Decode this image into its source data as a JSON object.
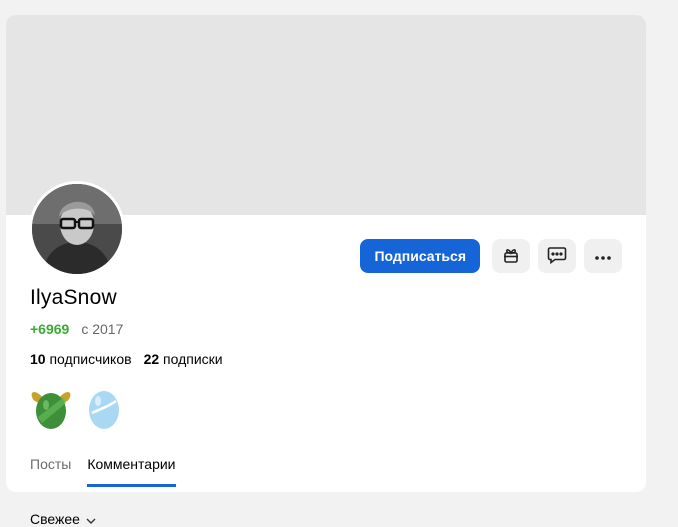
{
  "profile": {
    "name": "IlyaSnow",
    "karma": "+6969",
    "since": "с 2017",
    "subscribers_count": "10",
    "subscribers_label": "подписчиков",
    "subscriptions_count": "22",
    "subscriptions_label": "подписки"
  },
  "actions": {
    "subscribe_label": "Подписаться",
    "gift_icon": "gift-icon",
    "message_icon": "message-icon",
    "more_icon": "more-icon"
  },
  "badges": [
    "winged-green-egg-badge",
    "blue-egg-badge"
  ],
  "tabs": [
    {
      "label": "Посты",
      "active": false
    },
    {
      "label": "Комментарии",
      "active": true
    }
  ],
  "sort": {
    "label": "Свежее"
  },
  "colors": {
    "accent": "#1565d8",
    "karma": "#3aaa35",
    "cover": "#e5e5e5",
    "background": "#f2f2f2"
  }
}
